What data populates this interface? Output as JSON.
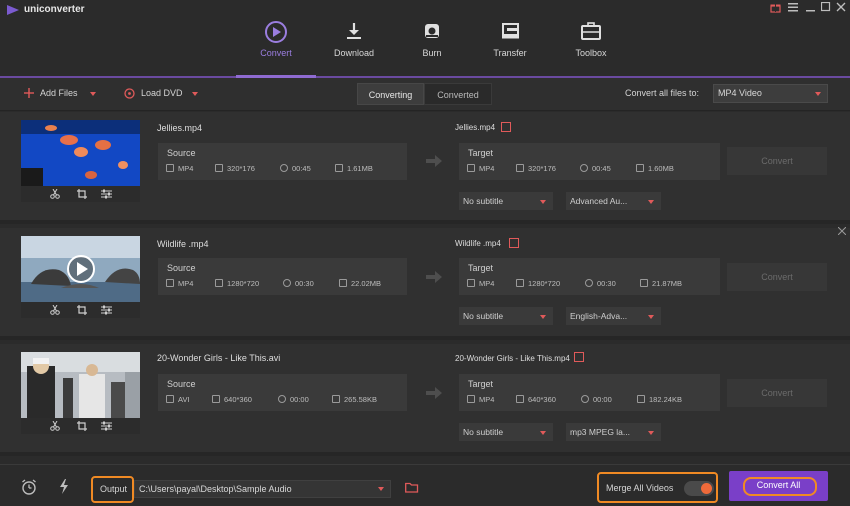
{
  "app": {
    "name": "uniconverter"
  },
  "nav": {
    "tabs": [
      {
        "label": "Convert",
        "icon": "convert-icon",
        "active": true
      },
      {
        "label": "Download",
        "icon": "download-icon"
      },
      {
        "label": "Burn",
        "icon": "burn-icon"
      },
      {
        "label": "Transfer",
        "icon": "transfer-icon"
      },
      {
        "label": "Toolbox",
        "icon": "toolbox-icon"
      }
    ]
  },
  "toolbar": {
    "add_files": "Add Files",
    "load_dvd": "Load DVD",
    "tab_converting": "Converting",
    "tab_converted": "Converted",
    "convert_all_label": "Convert all files to:",
    "format_value": "MP4 Video"
  },
  "files": [
    {
      "name": "Jellies.mp4",
      "target_name": "Jellies.mp4",
      "source": {
        "title": "Source",
        "format": "MP4",
        "resolution": "320*176",
        "duration": "00:45",
        "size": "1.61MB"
      },
      "target": {
        "title": "Target",
        "format": "MP4",
        "resolution": "320*176",
        "duration": "00:45",
        "size": "1.60MB"
      },
      "subtitle": "No subtitle",
      "audio": "Advanced Au...",
      "convert": "Convert"
    },
    {
      "name": "Wildlife .mp4",
      "target_name": "Wildlife .mp4",
      "source": {
        "title": "Source",
        "format": "MP4",
        "resolution": "1280*720",
        "duration": "00:30",
        "size": "22.02MB"
      },
      "target": {
        "title": "Target",
        "format": "MP4",
        "resolution": "1280*720",
        "duration": "00:30",
        "size": "21.87MB"
      },
      "subtitle": "No subtitle",
      "audio": "English-Adva...",
      "convert": "Convert"
    },
    {
      "name": "20-Wonder Girls - Like This.avi",
      "target_name": "20-Wonder Girls - Like This.mp4",
      "source": {
        "title": "Source",
        "format": "AVI",
        "resolution": "640*360",
        "duration": "00:00",
        "size": "265.58KB"
      },
      "target": {
        "title": "Target",
        "format": "MP4",
        "resolution": "640*360",
        "duration": "00:00",
        "size": "182.24KB"
      },
      "subtitle": "No subtitle",
      "audio": "mp3 MPEG la...",
      "convert": "Convert"
    }
  ],
  "bottom": {
    "output_label": "Output",
    "output_path": "C:\\Users\\payal\\Desktop\\Sample Audio",
    "merge_label": "Merge All Videos",
    "merge_on": true,
    "convert_all": "Convert All"
  },
  "colors": {
    "accent": "#8f6bd1",
    "highlight": "#f08a24",
    "danger": "#e05a5a",
    "convert_all_bg": "#7a3fc8"
  }
}
